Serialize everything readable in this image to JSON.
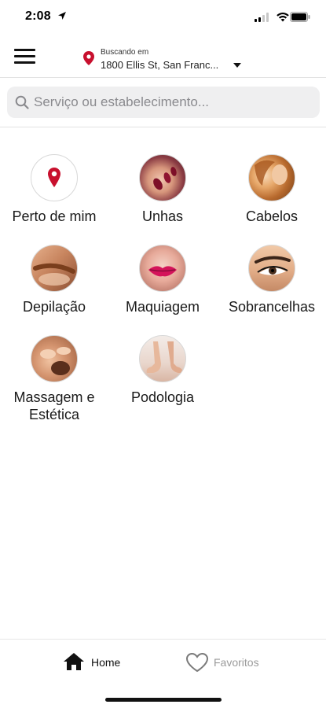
{
  "status_bar": {
    "time": "2:08",
    "icons": [
      "location-arrow-icon",
      "signal-icon",
      "wifi-icon",
      "battery-icon"
    ]
  },
  "header": {
    "menu_icon": "hamburger-menu-icon",
    "location_label": "Buscando em",
    "location_address": "1800 Ellis St, San Franc...",
    "location_icon": "map-pin-icon",
    "accent_color": "#c8102e"
  },
  "search": {
    "placeholder": "Serviço ou estabelecimento...",
    "value": ""
  },
  "categories": [
    {
      "label": "Perto de mim",
      "icon": "map-pin-icon"
    },
    {
      "label": "Unhas",
      "icon": "nails-photo"
    },
    {
      "label": "Cabelos",
      "icon": "hair-photo"
    },
    {
      "label": "Depilação",
      "icon": "waxing-photo"
    },
    {
      "label": "Maquiagem",
      "icon": "makeup-photo"
    },
    {
      "label": "Sobrancelhas",
      "icon": "eyebrows-photo"
    },
    {
      "label": "Massagem e Estética",
      "icon": "massage-photo"
    },
    {
      "label": "Podologia",
      "icon": "podology-photo"
    }
  ],
  "tabbar": {
    "home_label": "Home",
    "favorites_label": "Favoritos",
    "active_color": "#111111",
    "inactive_color": "#9b9b9b"
  }
}
